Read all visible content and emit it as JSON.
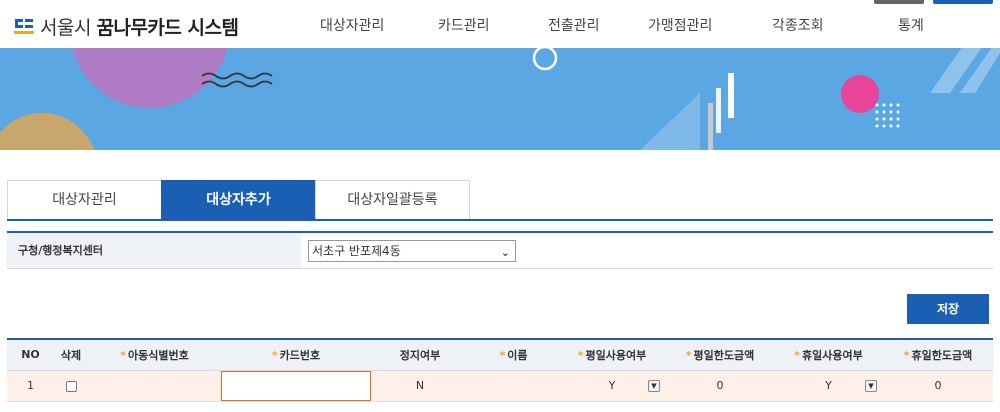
{
  "header": {
    "logo_prefix": "서울시 ",
    "logo_bold": "꿈나무카드 시스템",
    "nav": [
      {
        "label": "대상자관리"
      },
      {
        "label": "카드관리"
      },
      {
        "label": "전출관리"
      },
      {
        "label": "가맹점관리"
      },
      {
        "label": "각종조회"
      },
      {
        "label": "통계"
      }
    ]
  },
  "colors": {
    "accent": "#1a5fb4",
    "banner": "#5ba7e4",
    "required_mark": "#f5a623",
    "row_bg": "#fdf0e9"
  },
  "tabs": [
    {
      "label": "대상자관리",
      "active": false
    },
    {
      "label": "대상자추가",
      "active": true
    },
    {
      "label": "대상자일괄등록",
      "active": false
    }
  ],
  "filter": {
    "label": "구청/행정복지센터",
    "selected": "서초구 반포제4동"
  },
  "save_label": "저장",
  "table": {
    "columns": [
      {
        "label": "NO",
        "required": false
      },
      {
        "label": "삭제",
        "required": false
      },
      {
        "label": "아동식별번호",
        "required": true
      },
      {
        "label": "카드번호",
        "required": true
      },
      {
        "label": "정지여부",
        "required": false
      },
      {
        "label": "이름",
        "required": true
      },
      {
        "label": "평일사용여부",
        "required": true
      },
      {
        "label": "평일한도금액",
        "required": true
      },
      {
        "label": "휴일사용여부",
        "required": true
      },
      {
        "label": "휴일한도금액",
        "required": true
      }
    ],
    "required_mark": "*",
    "row": {
      "no": "1",
      "child_id": "",
      "card_no": "",
      "suspended": "N",
      "name": "",
      "weekday_use": "Y",
      "weekday_limit": "0",
      "holiday_use": "Y",
      "holiday_limit": "0"
    }
  },
  "icons": {
    "dropdown": "chevron-down-icon",
    "logo": "seoul-logo-icon"
  }
}
